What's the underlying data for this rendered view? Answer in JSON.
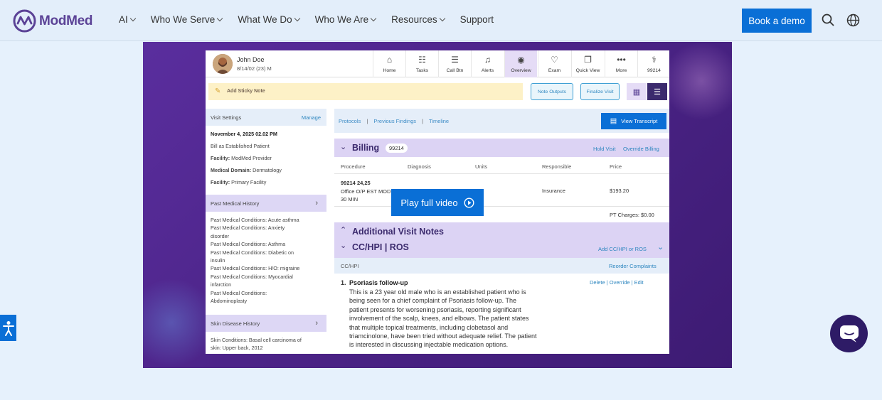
{
  "brand": {
    "name": "ModMed"
  },
  "nav": {
    "items": [
      {
        "label": "AI"
      },
      {
        "label": "Who We Serve"
      },
      {
        "label": "What We Do"
      },
      {
        "label": "Who We Are"
      },
      {
        "label": "Resources"
      }
    ],
    "support": "Support",
    "demo": "Book a demo"
  },
  "app": {
    "patient": {
      "name": "John Doe",
      "dob": "8/14/02 (23) M"
    },
    "toolbar": [
      "Home",
      "Tasks",
      "Call Btn",
      "Alerts",
      "Overview",
      "Exam",
      "Quick View",
      "More",
      "99214"
    ],
    "sticky": "Add Sticky Note",
    "note_outputs": "Note Outputs",
    "finalize": "Finalize Visit",
    "visit": {
      "title": "Visit Settings",
      "manage": "Manage",
      "date": "November 4, 2025 02.02 PM",
      "bill": "Bill as Established Patient",
      "facility_label": "Facility:",
      "facility_value": "ModMed Provider",
      "domain_label": "Medical Domain:",
      "domain_value": "Dermatology",
      "facility2_label": "Facility:",
      "facility2_value": "Primary  Facility"
    },
    "pmh": {
      "title": "Past Medical History",
      "lines": [
        "Past Medical Conditions: Acute asthma",
        "Past Medical Conditions: Anxiety",
        "disorder",
        "Past Medical Conditions: Asthma",
        "Past Medical Conditions: Diabetic on",
        "insulin",
        "Past Medical Conditions: H/O: migraine",
        "Past Medical Conditions: Myocardial",
        "infarction",
        "Past Medical Conditions:",
        "Abdominoplasty"
      ]
    },
    "skin": {
      "title": "Skin Disease History",
      "lines": [
        "Skin Conditions: Basal cell carcinoma of",
        "skin: Upper back, 2012"
      ]
    },
    "links": {
      "protocols": "Protocols",
      "sep1": "|",
      "findings": "Previous Findings",
      "sep2": "|",
      "timeline": "Timeline"
    },
    "transcript": "View Transcript",
    "billing": {
      "title": "Billing",
      "code": "99214",
      "hold": "Hold Visit",
      "override": "Override Billing",
      "cols": [
        "Procedure",
        "Diagnosis",
        "Units",
        "Responsible",
        "Price"
      ],
      "proc_code": "99214   24,25",
      "proc_desc": "Office O/P EST MOD",
      "proc_time": "30 MIN",
      "responsible": "Insurance",
      "price": "$193.20",
      "pt_charges": "PT Charges: $0.00"
    },
    "avn": "Additional Visit Notes",
    "cchpi": {
      "title": "CC/HPI | ROS",
      "add": "Add CC/HPI or ROS",
      "sub": "CC/HPI",
      "reorder": "Reorder Complaints"
    },
    "complaint": {
      "num": "1.",
      "title": "Psoriasis follow-up",
      "actions": "Delete | Override | Edit",
      "lines": [
        "This is a 23 year old male who is an established patient who is",
        "being seen for a chief complaint of Psoriasis follow-up. The",
        "patient presents for worsening psoriasis, reporting significant",
        "involvement of the scalp, knees, and elbows. The patient states",
        "that multiple topical treatments, including clobetasol and",
        "triamcinolone, have been tried without adequate relief. The patient",
        "is interested in discussing injectable medication options."
      ]
    }
  },
  "play": "Play full video",
  "colors": {
    "accent": "#0a6fd6",
    "brand": "#5b4296",
    "stage": "#4c2488"
  }
}
